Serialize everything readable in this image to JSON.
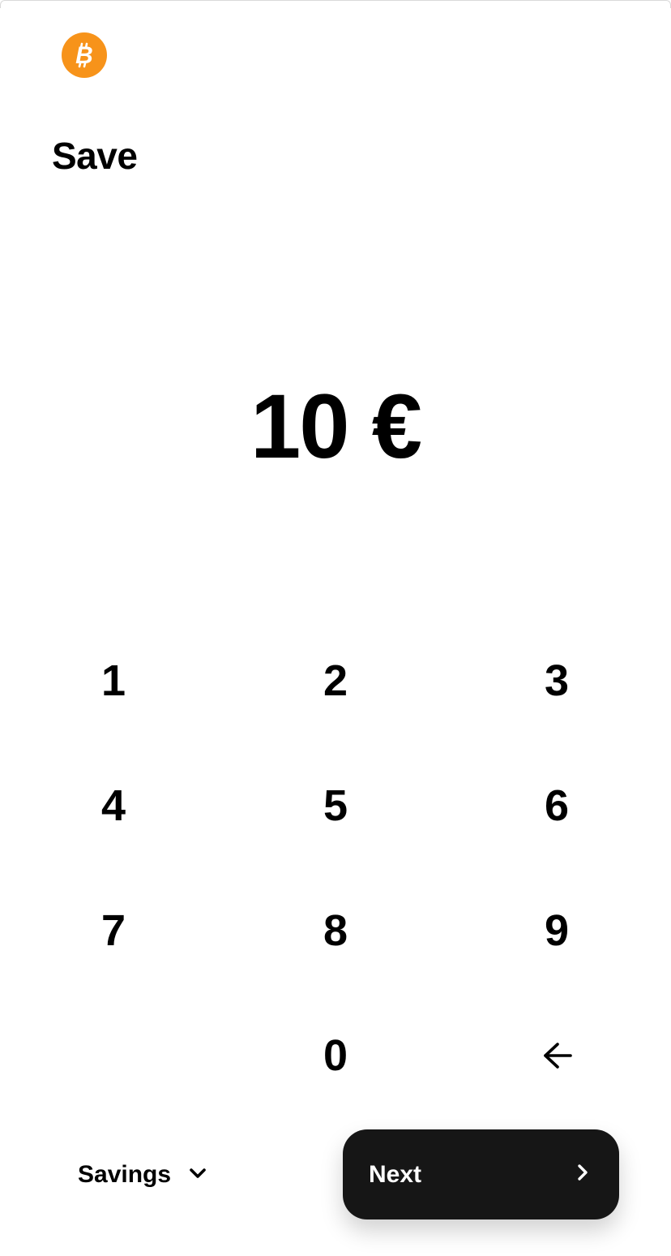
{
  "header": {
    "logo_icon": "bitcoin-icon",
    "logo_color": "#F7931A",
    "title": "Save"
  },
  "amount": {
    "display": "10 €",
    "value": 10,
    "currency": "€"
  },
  "keypad": {
    "keys": [
      "1",
      "2",
      "3",
      "4",
      "5",
      "6",
      "7",
      "8",
      "9",
      "0"
    ],
    "backspace_icon": "arrow-left-icon"
  },
  "footer": {
    "account_label": "Savings",
    "account_icon": "chevron-down-icon",
    "next_label": "Next",
    "next_icon": "chevron-right-icon",
    "next_button_color": "#161616"
  }
}
